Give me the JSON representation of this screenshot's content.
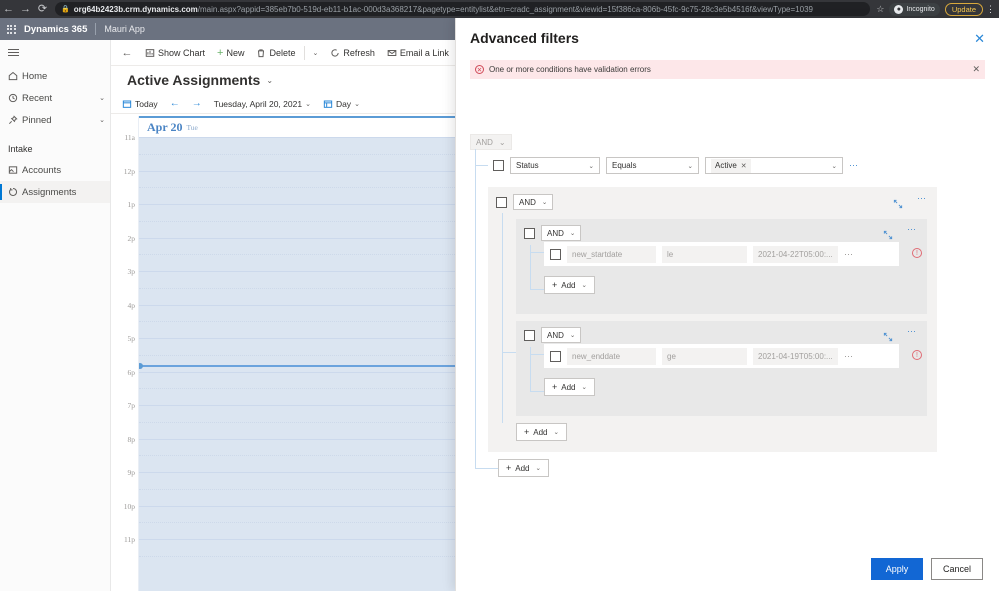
{
  "browser": {
    "back_icon": "back-arrow-icon",
    "forward_icon": "forward-arrow-icon",
    "reload_icon": "reload-icon",
    "lock_icon": "lock-icon",
    "url_host": "org64b2423b.crm.dynamics.com",
    "url_path": "/main.aspx?appid=385eb7b0-519d-eb11-b1ac-000d3a368217&pagetype=entitylist&etn=cradc_assignment&viewid=15f386ca-806b-45fc-9c75-28c3e5b4516f&viewType=1039",
    "star_icon": "bookmark-star-icon",
    "incognito_label": "Incognito",
    "update_label": "Update",
    "menu_icon": "browser-menu-icon"
  },
  "app_header": {
    "waffle_icon": "app-launcher-icon",
    "brand": "Dynamics 365",
    "app_name": "Mauri App"
  },
  "sidebar": {
    "hamburger_icon": "hamburger-menu-icon",
    "items": [
      {
        "label": "Home",
        "icon": "home-icon",
        "chevron": ""
      },
      {
        "label": "Recent",
        "icon": "clock-icon",
        "chevron": "⌄"
      },
      {
        "label": "Pinned",
        "icon": "pin-icon",
        "chevron": "⌄"
      }
    ],
    "group_title": "Intake",
    "group_items": [
      {
        "label": "Accounts",
        "icon": "accounts-icon"
      },
      {
        "label": "Assignments",
        "icon": "assignments-icon"
      }
    ]
  },
  "command_bar": {
    "back_icon": "back-arrow-icon",
    "commands": [
      {
        "label": "Show Chart",
        "icon": "chart-icon"
      },
      {
        "label": "New",
        "icon": "plus-icon"
      },
      {
        "label": "Delete",
        "icon": "trash-icon"
      }
    ],
    "overflow_chevron_1": "⌄",
    "commands2": [
      {
        "label": "Refresh",
        "icon": "refresh-icon"
      },
      {
        "label": "Email a Link",
        "icon": "email-link-icon"
      }
    ],
    "overflow_chevron_2": "⌄"
  },
  "page": {
    "title": "Active Assignments",
    "title_chevron": "⌄"
  },
  "calendar_toolbar": {
    "today_label": "Today",
    "today_icon": "calendar-today-icon",
    "prev_icon": "←",
    "next_icon": "→",
    "date_label": "Tuesday, April 20, 2021",
    "date_chevron": "⌄",
    "view_icon": "calendar-view-icon",
    "view_label": "Day",
    "view_chevron": "⌄"
  },
  "calendar": {
    "day_title": "Apr 20",
    "day_of_week": "Tue",
    "time_labels": [
      "11a",
      "12p",
      "1p",
      "2p",
      "3p",
      "4p",
      "5p",
      "6p",
      "7p",
      "8p",
      "9p",
      "10p",
      "11p"
    ]
  },
  "panel": {
    "title": "Advanced filters",
    "close_icon": "close-icon",
    "error": {
      "icon": "error-circle-icon",
      "text": "One or more conditions have validation errors",
      "dismiss_icon": "close-icon"
    },
    "root_operator": "AND",
    "root_chevron": "⌄",
    "row1": {
      "attribute": "Status",
      "operator": "Equals",
      "value_chip": "Active",
      "chip_remove_icon": "remove-chip-icon",
      "attribute_chevron": "⌄",
      "operator_chevron": "⌄",
      "value_chevron": "⌄",
      "more_icon": "more-options-icon"
    },
    "group1": {
      "operator": "AND",
      "chevron": "⌄",
      "collapse_icon": "collapse-icon",
      "more_icon": "more-options-icon",
      "subgroup1": {
        "operator": "AND",
        "chevron": "⌄",
        "collapse_icon": "collapse-icon",
        "more_icon": "more-options-icon",
        "condition": {
          "attribute": "new_startdate",
          "operator": "le",
          "value": "2021-04-22T05:00:...",
          "more_icon": "more-options-icon",
          "error_icon": "error-circle-icon"
        },
        "add_label": "Add",
        "add_chevron": "⌄"
      },
      "subgroup2": {
        "operator": "AND",
        "chevron": "⌄",
        "collapse_icon": "collapse-icon",
        "more_icon": "more-options-icon",
        "condition": {
          "attribute": "new_enddate",
          "operator": "ge",
          "value": "2021-04-19T05:00:...",
          "more_icon": "more-options-icon",
          "error_icon": "error-circle-icon"
        },
        "add_label": "Add",
        "add_chevron": "⌄"
      },
      "add_label": "Add",
      "add_chevron": "⌄"
    },
    "root_add_label": "Add",
    "root_add_chevron": "⌄",
    "apply_label": "Apply",
    "cancel_label": "Cancel"
  },
  "colors": {
    "accent": "#1267d4",
    "panel_link": "#2b88d8",
    "error_bg": "#fde7e9",
    "error_fg": "#d04a58",
    "calendar_bg": "#dbe5f1",
    "app_header_bg": "#6b7280"
  }
}
